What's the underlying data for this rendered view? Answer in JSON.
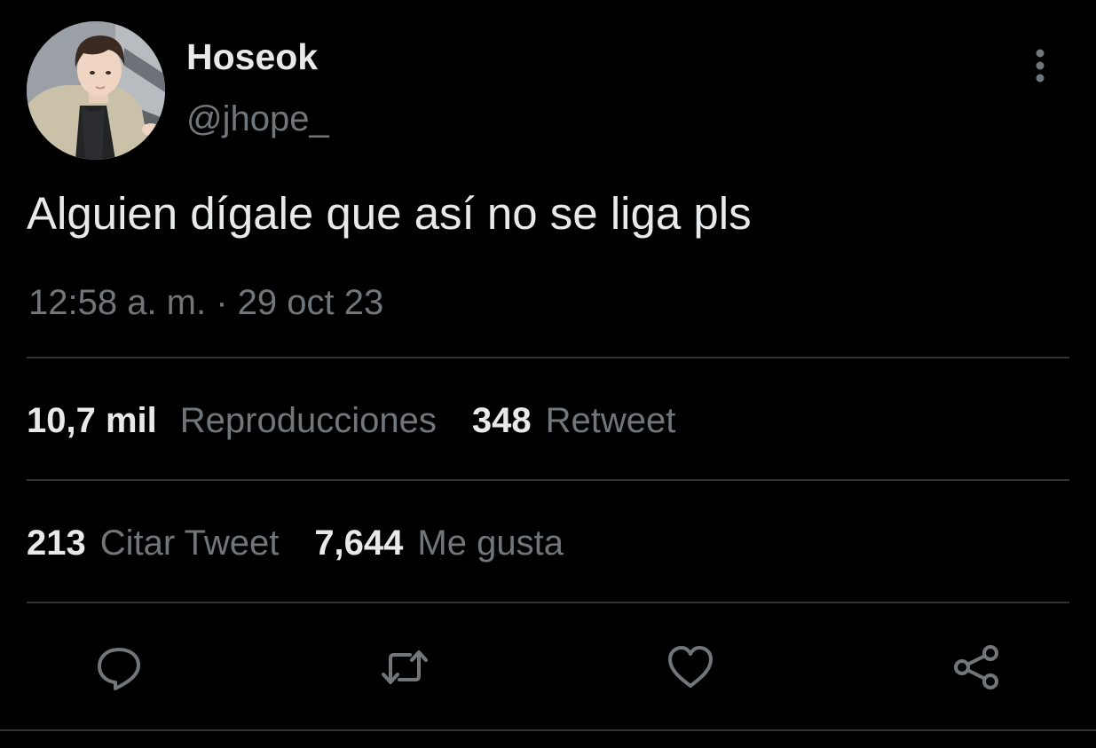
{
  "author": {
    "display_name": "Hoseok",
    "handle": "@jhope_"
  },
  "tweet": {
    "text": "Alguien dígale que así no se liga pls",
    "timestamp": "12:58 a. m. · 29 oct 23"
  },
  "stats": {
    "views_count": "10,7 mil",
    "views_label": "Reproducciones",
    "retweets_count": "348",
    "retweets_label": "Retweet",
    "quotes_count": "213",
    "quotes_label": "Citar Tweet",
    "likes_count": "7,644",
    "likes_label": "Me gusta"
  },
  "actions": {
    "reply_icon": "reply-icon",
    "retweet_icon": "retweet-icon",
    "like_icon": "heart-icon",
    "share_icon": "share-icon"
  },
  "colors": {
    "background": "#000000",
    "text_primary": "#e7e9ea",
    "text_secondary": "#71767b",
    "divider": "#2f3336",
    "icon": "#71767b"
  }
}
